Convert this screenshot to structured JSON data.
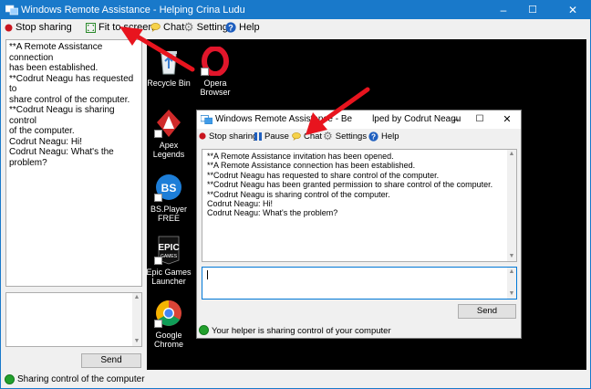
{
  "window": {
    "title": "Windows Remote Assistance - Helping Crina Ludu",
    "min": "–",
    "max": "☐",
    "close": "✕"
  },
  "toolbar": {
    "stop_sharing": "Stop sharing",
    "fit_to_screen": "Fit to screen",
    "chat": "Chat",
    "settings": "Settings",
    "help": "Help"
  },
  "chat_log": [
    "**A Remote Assistance connection",
    "has been established.",
    "**Codrut Neagu has requested to",
    "share control of the computer.",
    "**Codrut Neagu is sharing control",
    "of the computer.",
    "Codrut Neagu: Hi!",
    "Codrut Neagu: What's the",
    "problem?"
  ],
  "send_label": "Send",
  "status": "Sharing control of the computer",
  "desktop_icons": [
    {
      "label": "Recycle Bin",
      "icon": "recycle-bin-icon"
    },
    {
      "label": "Opera Browser",
      "icon": "opera-icon"
    },
    {
      "label": "Apex Legends",
      "icon": "apex-icon"
    },
    {
      "label": "BS.Player FREE",
      "icon": "bsplayer-icon"
    },
    {
      "label": "Epic Games Launcher",
      "icon": "epic-icon"
    },
    {
      "label": "Google Chrome",
      "icon": "chrome-icon"
    }
  ],
  "inner_window": {
    "title_left": "Windows Remote Assistance - Be",
    "title_right": "lped by Codrut Neagu",
    "toolbar": {
      "stop_sharing": "Stop sharing",
      "pause": "Pause",
      "chat": "Chat",
      "settings": "Settings",
      "help": "Help"
    },
    "chat_log": [
      "**A Remote Assistance invitation has been opened.",
      "**A Remote Assistance connection has been established.",
      "**Codrut Neagu has requested to share control of the computer.",
      "**Codrut Neagu has been granted permission to share control of the computer.",
      "**Codrut Neagu is sharing control of the computer.",
      "Codrut Neagu: Hi!",
      "Codrut Neagu: What's the problem?"
    ],
    "send_label": "Send",
    "status": "Your helper is sharing control of your computer"
  },
  "colors": {
    "titlebar": "#1979ca",
    "arrow": "#e8141e",
    "status_green": "#22a02d",
    "stop_red": "#c8141e"
  }
}
